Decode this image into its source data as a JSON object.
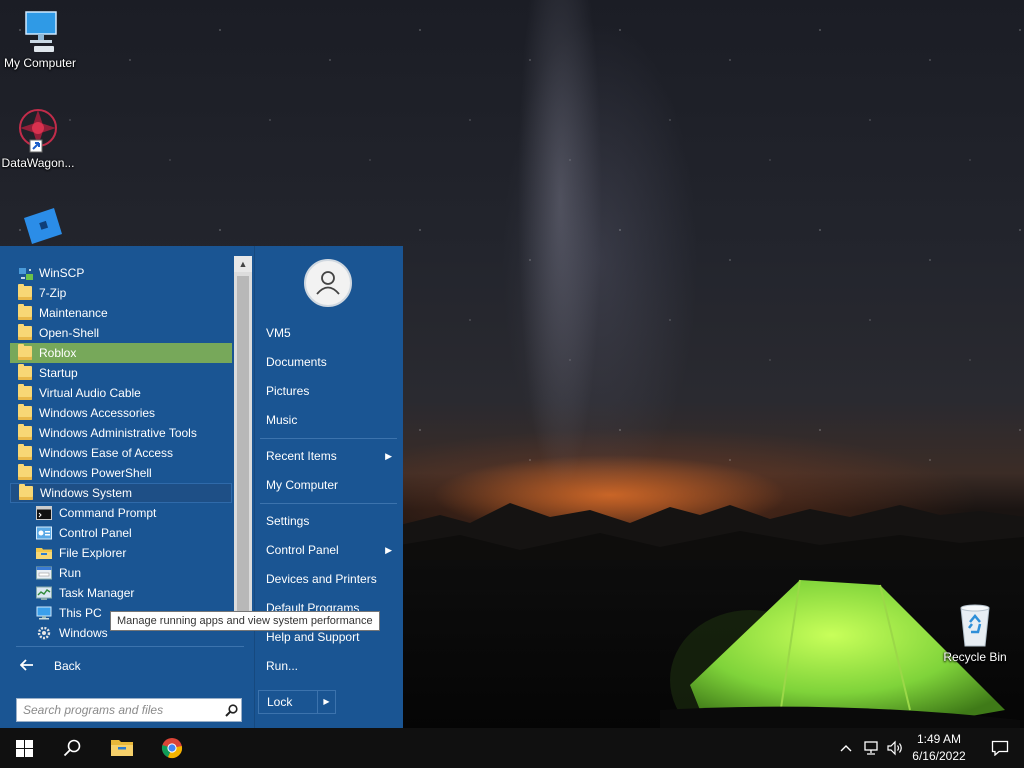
{
  "desktop": {
    "icons": [
      {
        "label": "My Computer"
      },
      {
        "label": "DataWagon..."
      },
      {
        "label": "Recycle Bin"
      }
    ]
  },
  "start_menu": {
    "programs": [
      {
        "label": "WinSCP",
        "icon": "winscp-icon"
      },
      {
        "label": "7-Zip",
        "icon": "folder-icon"
      },
      {
        "label": "Maintenance",
        "icon": "folder-icon"
      },
      {
        "label": "Open-Shell",
        "icon": "folder-icon"
      },
      {
        "label": "Roblox",
        "icon": "folder-icon",
        "state": "highlighted"
      },
      {
        "label": "Startup",
        "icon": "folder-icon"
      },
      {
        "label": "Virtual Audio Cable",
        "icon": "folder-icon"
      },
      {
        "label": "Windows Accessories",
        "icon": "folder-icon"
      },
      {
        "label": "Windows Administrative Tools",
        "icon": "folder-icon"
      },
      {
        "label": "Windows Ease of Access",
        "icon": "folder-icon"
      },
      {
        "label": "Windows PowerShell",
        "icon": "folder-icon"
      },
      {
        "label": "Windows System",
        "icon": "folder-icon",
        "state": "expanded"
      },
      {
        "label": "Command Prompt",
        "icon": "cmd-icon"
      },
      {
        "label": "Control Panel",
        "icon": "control-panel-icon"
      },
      {
        "label": "File Explorer",
        "icon": "file-explorer-icon"
      },
      {
        "label": "Run",
        "icon": "run-icon"
      },
      {
        "label": "Task Manager",
        "icon": "task-manager-icon"
      },
      {
        "label": "This PC",
        "icon": "this-pc-icon"
      },
      {
        "label": "Windows",
        "icon": "gear-icon"
      }
    ],
    "back_label": "Back",
    "search_placeholder": "Search programs and files",
    "tooltip": "Manage running apps and view system performance",
    "user": "VM5",
    "right_items": [
      {
        "label": "Documents"
      },
      {
        "label": "Pictures"
      },
      {
        "label": "Music"
      },
      {
        "label": "Recent Items",
        "submenu": true
      },
      {
        "label": "My Computer"
      },
      {
        "label": "Settings"
      },
      {
        "label": "Control Panel",
        "submenu": true
      },
      {
        "label": "Devices and Printers"
      },
      {
        "label": "Default Programs"
      },
      {
        "label": "Help and Support"
      },
      {
        "label": "Run..."
      }
    ],
    "lock_label": "Lock"
  },
  "taskbar": {
    "time": "1:49 AM",
    "date": "6/16/2022"
  },
  "colors": {
    "menu_bg": "#1a5593",
    "highlight": "#77a85a",
    "taskbar": "#101010"
  }
}
